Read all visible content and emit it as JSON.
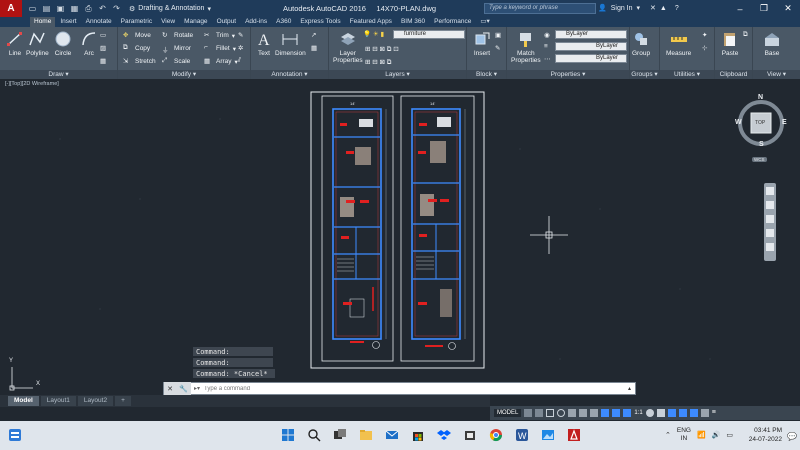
{
  "titlebar": {
    "app_letter": "A",
    "workspace": "Drafting & Annotation",
    "app_name": "Autodesk AutoCAD 2016",
    "file_name": "14X70-PLAN.dwg",
    "search_placeholder": "Type a keyword or phrase",
    "sign_in": "Sign In"
  },
  "tabs": [
    "Home",
    "Insert",
    "Annotate",
    "Parametric",
    "View",
    "Manage",
    "Output",
    "Add-ins",
    "A360",
    "Express Tools",
    "Featured Apps",
    "BIM 360",
    "Performance"
  ],
  "ribbon": {
    "draw": {
      "label": "Draw",
      "line": "Line",
      "polyline": "Polyline",
      "circle": "Circle",
      "arc": "Arc"
    },
    "modify": {
      "label": "Modify",
      "move": "Move",
      "rotate": "Rotate",
      "trim": "Trim",
      "copy": "Copy",
      "mirror": "Mirror",
      "fillet": "Fillet",
      "stretch": "Stretch",
      "scale": "Scale",
      "array": "Array"
    },
    "annotation": {
      "label": "Annotation",
      "text": "Text",
      "dimension": "Dimension"
    },
    "layers": {
      "label": "Layers",
      "layer_properties_line1": "Layer",
      "layer_properties_line2": "Properties",
      "current_layer": "furniture"
    },
    "block": {
      "label": "Block",
      "insert": "Insert"
    },
    "properties": {
      "label": "Properties",
      "match_line1": "Match",
      "match_line2": "Properties",
      "color": "ByLayer",
      "linetype": "ByLayer",
      "lineweight": "ByLayer"
    },
    "groups": {
      "label": "Groups",
      "group": "Group"
    },
    "utilities": {
      "label": "Utilities",
      "measure": "Measure"
    },
    "clipboard": {
      "label": "Clipboard",
      "paste": "Paste"
    },
    "view": {
      "label": "View",
      "base": "Base"
    }
  },
  "viewport": {
    "label": "[-][Top][2D Wireframe]",
    "viewcube": {
      "n": "N",
      "s": "S",
      "e": "E",
      "w": "W",
      "top": "TOP",
      "wcs": "WCS"
    },
    "ucs_y": "Y",
    "ucs_x": "X"
  },
  "command": {
    "history": [
      "Command:",
      "Command:",
      "Command: *Cancel*"
    ],
    "placeholder": "Type a command"
  },
  "layout_tabs": [
    "Model",
    "Layout1",
    "Layout2"
  ],
  "status": {
    "model": "MODEL",
    "scale": "1:1"
  },
  "taskbar": {
    "lang_line1": "ENG",
    "lang_line2": "IN",
    "time": "03:41 PM",
    "date": "24-07-2022"
  }
}
